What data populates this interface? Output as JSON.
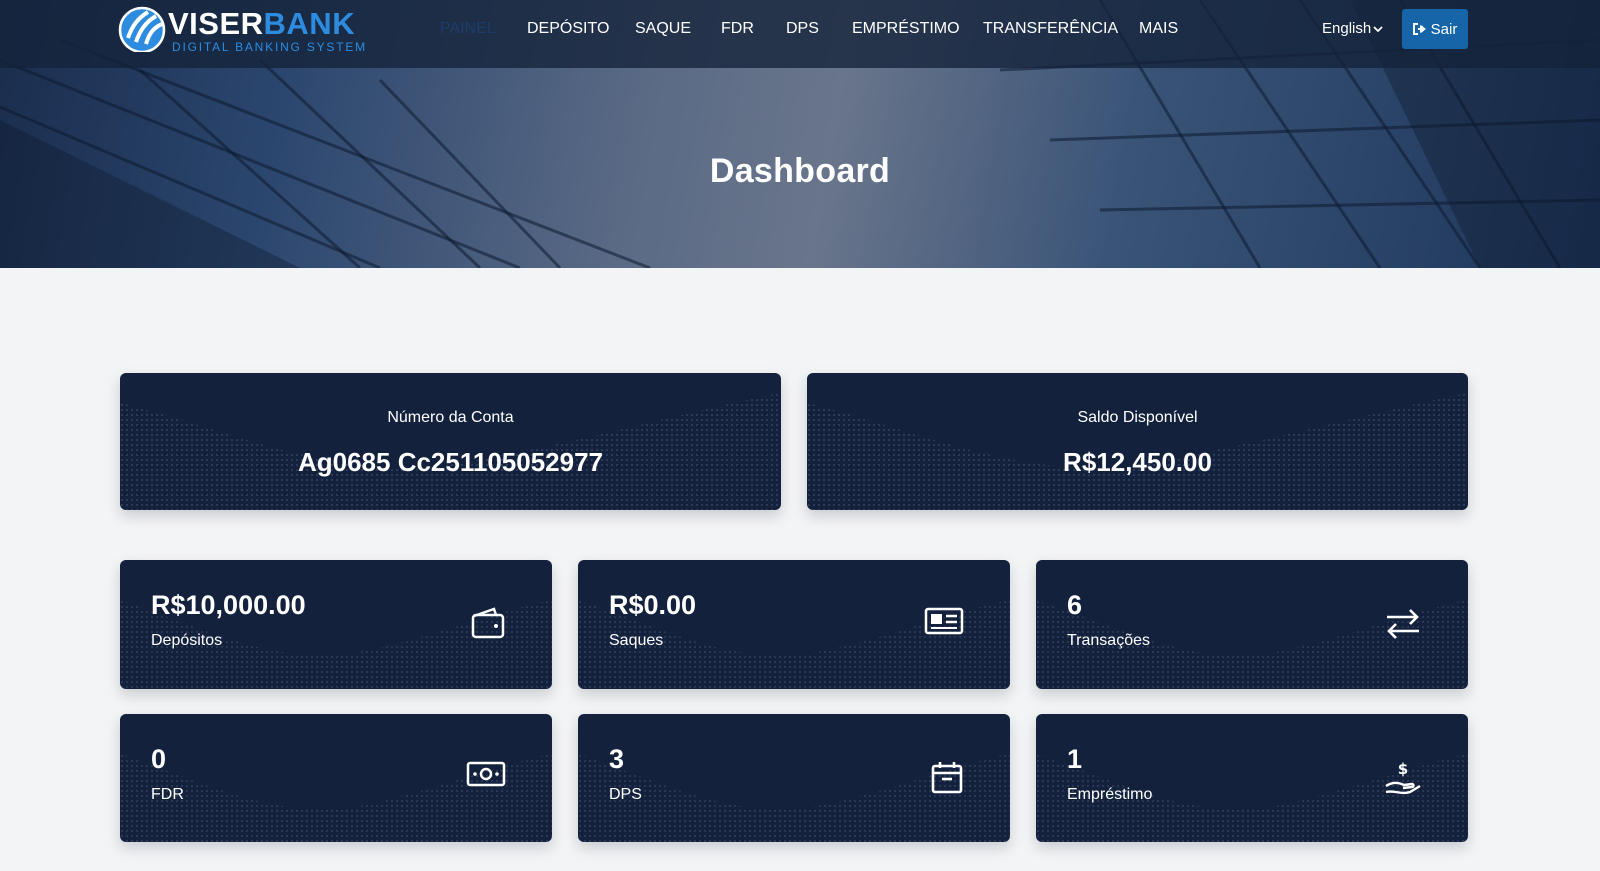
{
  "brand": {
    "name_part1": "VISER",
    "name_part2": "BANK",
    "tagline": "DIGITAL BANKING SYSTEM"
  },
  "nav": {
    "items": [
      {
        "label": "PAINEL",
        "active": true
      },
      {
        "label": "DEPÓSITO"
      },
      {
        "label": "SAQUE"
      },
      {
        "label": "FDR"
      },
      {
        "label": "DPS"
      },
      {
        "label": "EMPRÉSTIMO"
      },
      {
        "label": "TRANSFERÊNCIA"
      },
      {
        "label": "MAIS"
      }
    ],
    "language": "English",
    "logout_label": "Sair"
  },
  "hero": {
    "title": "Dashboard"
  },
  "account": {
    "number_label": "Número da Conta",
    "number_value": "Ag0685 Cc251105052977",
    "balance_label": "Saldo Disponível",
    "balance_value": "R$12,450.00"
  },
  "stats": [
    {
      "value": "R$10,000.00",
      "label": "Depósitos",
      "icon": "wallet-icon"
    },
    {
      "value": "R$0.00",
      "label": "Saques",
      "icon": "id-card-icon"
    },
    {
      "value": "6",
      "label": "Transações",
      "icon": "exchange-arrows-icon"
    },
    {
      "value": "0",
      "label": "FDR",
      "icon": "money-bill-icon"
    },
    {
      "value": "3",
      "label": "DPS",
      "icon": "archive-box-icon"
    },
    {
      "value": "1",
      "label": "Empréstimo",
      "icon": "hand-dollar-icon"
    }
  ],
  "colors": {
    "card_bg": "#13213d",
    "accent": "#2d8ce0",
    "button": "#1565a8",
    "active_nav": "#1d3d6b"
  }
}
